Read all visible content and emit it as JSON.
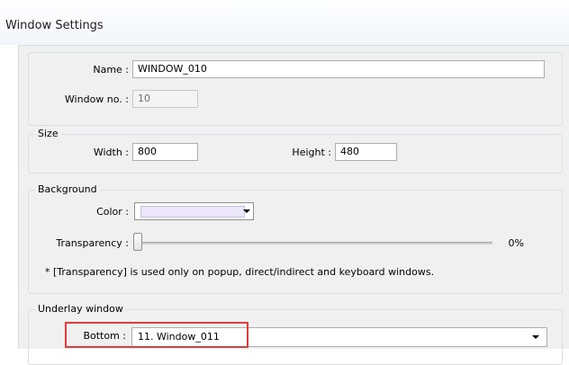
{
  "window": {
    "title": "Window Settings"
  },
  "general": {
    "name_label": "Name :",
    "name_value": "WINDOW_010",
    "window_no_label": "Window no. :",
    "window_no_value": "10"
  },
  "size": {
    "legend": "Size",
    "width_label": "Width :",
    "width_value": "800",
    "height_label": "Height :",
    "height_value": "480"
  },
  "background": {
    "legend": "Background",
    "color_label": "Color :",
    "color_value": "#ece6fb",
    "transparency_label": "Transparency :",
    "transparency_value": "0%",
    "transparency_level": 0,
    "note": "* [Transparency] is used only on popup, direct/indirect and keyboard windows."
  },
  "underlay": {
    "legend": "Underlay window",
    "bottom_label": "Bottom :",
    "bottom_value": "11. Window_011"
  },
  "colors": {
    "highlight": "#e03d3d"
  }
}
